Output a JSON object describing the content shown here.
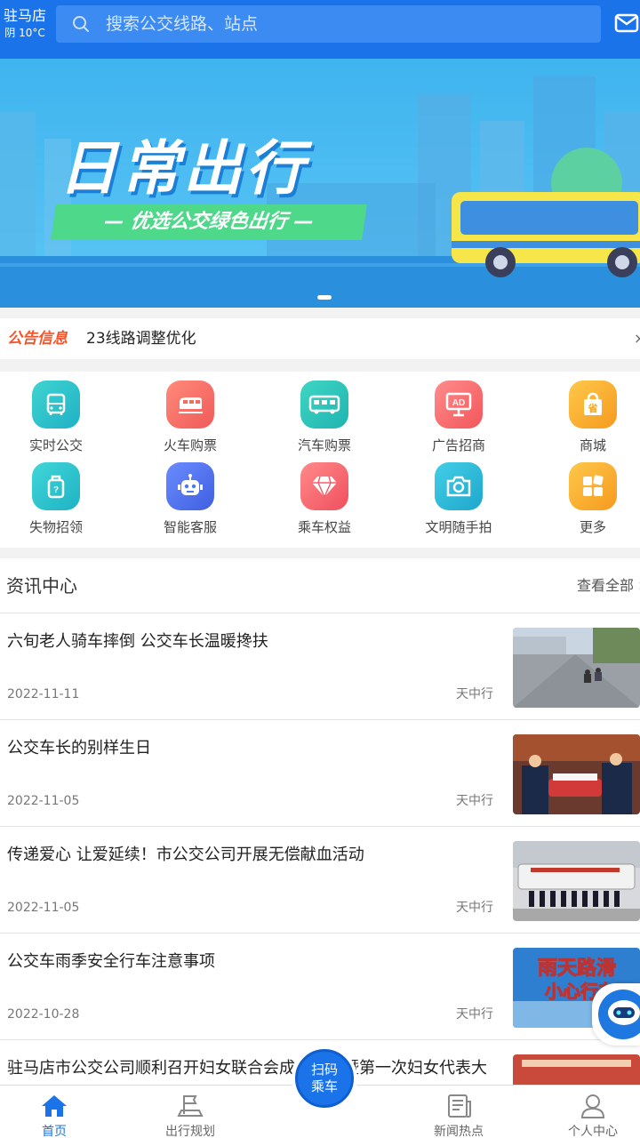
{
  "header": {
    "city": "驻马店",
    "weather": "阴 10°C",
    "search_placeholder": "搜索公交线路、站点"
  },
  "banner": {
    "title": "日常出行",
    "subtitle": "— 优选公交绿色出行 —"
  },
  "notice": {
    "tag": "公告信息",
    "text": "23线路调整优化",
    "close": "×"
  },
  "grid": [
    {
      "label": "实时公交",
      "icon": "bus-icon",
      "color": "#27c2c9"
    },
    {
      "label": "火车购票",
      "icon": "train-icon",
      "color": "#f26d5b"
    },
    {
      "label": "汽车购票",
      "icon": "coach-icon",
      "color": "#2bc4b8"
    },
    {
      "label": "广告招商",
      "icon": "ad-icon",
      "color": "#f46d6d"
    },
    {
      "label": "商城",
      "icon": "shop-bag-icon",
      "color": "#f5a623"
    },
    {
      "label": "失物招领",
      "icon": "luggage-icon",
      "color": "#2cc4c8"
    },
    {
      "label": "智能客服",
      "icon": "robot-icon",
      "color": "#4a78f0"
    },
    {
      "label": "乘车权益",
      "icon": "diamond-icon",
      "color": "#f2606b"
    },
    {
      "label": "文明随手拍",
      "icon": "camera-icon",
      "color": "#2ab8d6"
    },
    {
      "label": "更多",
      "icon": "more-icon",
      "color": "#f5a623"
    }
  ],
  "news": {
    "title": "资讯中心",
    "view_all": "查看全部 >",
    "items": [
      {
        "title": "六旬老人骑车摔倒 公交车长温暖搀扶",
        "date": "2022-11-11",
        "source": "天中行"
      },
      {
        "title": "公交车长的别样生日",
        "date": "2022-11-05",
        "source": "天中行"
      },
      {
        "title": "传递爱心 让爱延续！市公交公司开展无偿献血活动",
        "date": "2022-11-05",
        "source": "天中行"
      },
      {
        "title": "公交车雨季安全行车注意事项",
        "date": "2022-10-28",
        "source": "天中行"
      },
      {
        "title": "驻马店市公交公司顺利召开妇女联合会成立大会暨第一次妇女代表大",
        "date": "",
        "source": ""
      }
    ]
  },
  "tabbar": {
    "home": "首页",
    "plan": "出行规划",
    "scan": "扫码乘车",
    "news": "新闻热点",
    "me": "个人中心"
  },
  "thumb_text": {
    "rain_line1": "雨天路滑",
    "rain_line2": "小心行车"
  },
  "colors": {
    "primary": "#1a73e8",
    "notice_tag": "#f2562c",
    "banner_sub": "#4ed88a"
  }
}
